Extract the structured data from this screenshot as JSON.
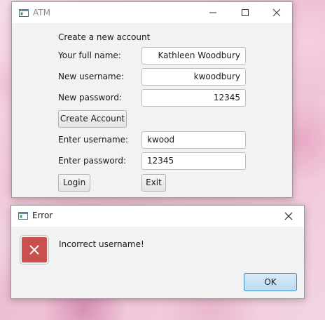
{
  "main_window": {
    "title": "ATM",
    "heading": "Create a new account",
    "full_name_label": "Your full name:",
    "full_name_value": "Kathleen Woodbury",
    "new_username_label": "New username:",
    "new_username_value": "kwoodbury",
    "new_password_label": "New password:",
    "new_password_value": "12345",
    "create_account_label": "Create Account",
    "enter_username_label": "Enter username:",
    "enter_username_value": "kwood",
    "enter_password_label": "Enter password:",
    "enter_password_value": "12345",
    "login_label": "Login",
    "exit_label": "Exit"
  },
  "error_dialog": {
    "title": "Error",
    "message": "Incorrect username!",
    "ok_label": "OK",
    "icon": "error-x-icon"
  },
  "colors": {
    "error_red": "#c9504f",
    "ok_blue": "#bcdcf1",
    "window_bg": "#f2f2f2"
  }
}
